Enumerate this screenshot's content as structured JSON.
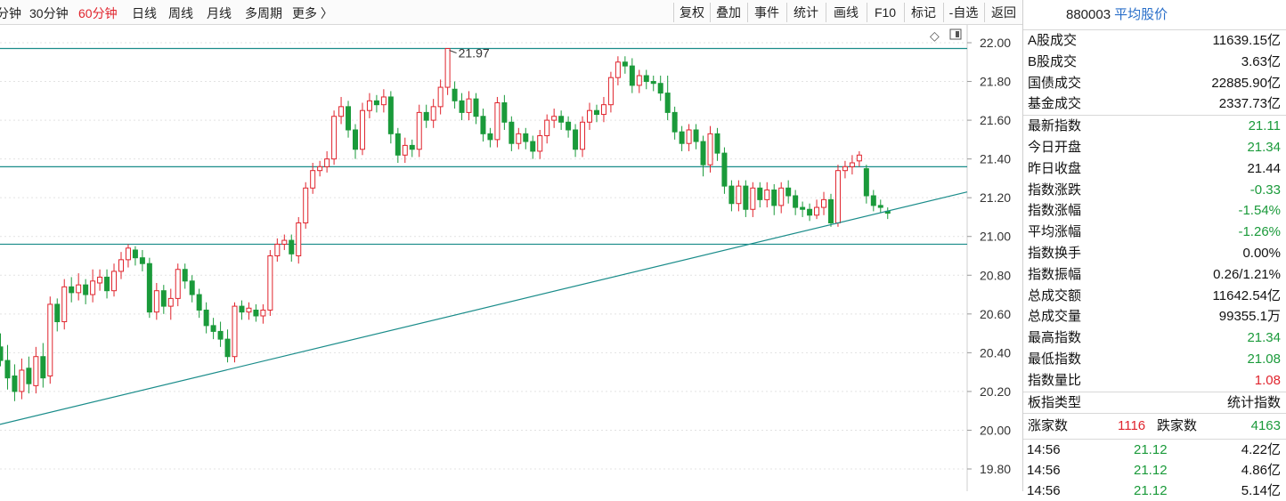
{
  "toolbar": {
    "periods": [
      {
        "label": "分钟",
        "active": false
      },
      {
        "label": "30分钟",
        "active": false
      },
      {
        "label": "60分钟",
        "active": true
      },
      {
        "label": "日线",
        "active": false
      },
      {
        "label": "周线",
        "active": false
      },
      {
        "label": "月线",
        "active": false
      },
      {
        "label": "多周期",
        "active": false
      },
      {
        "label": "更多 〉",
        "active": false
      }
    ],
    "tools": [
      "复权",
      "叠加",
      "事件",
      "统计",
      "画线",
      "F10",
      "标记",
      "-自选",
      "返回"
    ],
    "diamond_icon": "◇",
    "panel_icon": "□"
  },
  "chart": {
    "price_axis_ticks": [
      "22.00",
      "21.80",
      "21.60",
      "21.40",
      "21.20",
      "21.00",
      "20.80",
      "20.60",
      "20.40",
      "20.20",
      "20.00",
      "19.80"
    ],
    "high_marker_label": "21.97",
    "up_color": "#e0242d",
    "down_color": "#1a9a3a",
    "line_color": "#1a8c8a"
  },
  "chart_data": {
    "type": "candlestick",
    "period": "60分钟",
    "price_range": [
      19.8,
      22.0
    ],
    "horizontal_lines": [
      21.97,
      21.36,
      20.96
    ],
    "trendline": {
      "from_price": 20.03,
      "to_price": 21.23
    },
    "candles": [
      [
        20.43,
        20.36,
        20.5,
        20.33
      ],
      [
        20.36,
        20.27,
        20.44,
        20.21
      ],
      [
        20.28,
        20.2,
        20.34,
        20.15
      ],
      [
        20.2,
        20.31,
        20.37,
        20.16
      ],
      [
        20.32,
        20.24,
        20.38,
        20.19
      ],
      [
        20.23,
        20.38,
        20.43,
        20.19
      ],
      [
        20.38,
        20.27,
        20.45,
        20.22
      ],
      [
        20.28,
        20.65,
        20.69,
        20.24
      ],
      [
        20.65,
        20.56,
        20.68,
        20.51
      ],
      [
        20.56,
        20.74,
        20.78,
        20.52
      ],
      [
        20.74,
        20.71,
        20.79,
        20.66
      ],
      [
        20.71,
        20.75,
        20.81,
        20.67
      ],
      [
        20.75,
        20.7,
        20.78,
        20.65
      ],
      [
        20.7,
        20.77,
        20.83,
        20.66
      ],
      [
        20.76,
        20.79,
        20.83,
        20.72
      ],
      [
        20.79,
        20.72,
        20.83,
        20.68
      ],
      [
        20.72,
        20.82,
        20.86,
        20.69
      ],
      [
        20.82,
        20.88,
        20.92,
        20.78
      ],
      [
        20.88,
        20.94,
        20.96,
        20.84
      ],
      [
        20.93,
        20.89,
        20.95,
        20.85
      ],
      [
        20.89,
        20.86,
        20.93,
        20.82
      ],
      [
        20.86,
        20.61,
        20.89,
        20.58
      ],
      [
        20.61,
        20.72,
        20.76,
        20.57
      ],
      [
        20.72,
        20.64,
        20.75,
        20.6
      ],
      [
        20.64,
        20.68,
        20.73,
        20.57
      ],
      [
        20.68,
        20.83,
        20.86,
        20.64
      ],
      [
        20.83,
        20.77,
        20.86,
        20.73
      ],
      [
        20.77,
        20.7,
        20.8,
        20.66
      ],
      [
        20.7,
        20.62,
        20.73,
        20.58
      ],
      [
        20.62,
        20.54,
        20.66,
        20.5
      ],
      [
        20.54,
        20.51,
        20.58,
        20.47
      ],
      [
        20.51,
        20.47,
        20.56,
        20.43
      ],
      [
        20.47,
        20.38,
        20.52,
        20.35
      ],
      [
        20.38,
        20.64,
        20.66,
        20.35
      ],
      [
        20.64,
        20.61,
        20.67,
        20.57
      ],
      [
        20.61,
        20.63,
        20.66,
        20.57
      ],
      [
        20.62,
        20.59,
        20.65,
        20.56
      ],
      [
        20.59,
        20.62,
        20.65,
        20.55
      ],
      [
        20.62,
        20.9,
        20.93,
        20.59
      ],
      [
        20.9,
        20.96,
        20.99,
        20.87
      ],
      [
        20.96,
        20.98,
        21.01,
        20.93
      ],
      [
        20.98,
        20.91,
        21.01,
        20.87
      ],
      [
        20.9,
        21.07,
        21.1,
        20.86
      ],
      [
        21.07,
        21.25,
        21.28,
        21.04
      ],
      [
        21.25,
        21.34,
        21.38,
        21.22
      ],
      [
        21.34,
        21.36,
        21.39,
        21.31
      ],
      [
        21.36,
        21.4,
        21.44,
        21.33
      ],
      [
        21.4,
        21.62,
        21.65,
        21.37
      ],
      [
        21.62,
        21.67,
        21.72,
        21.58
      ],
      [
        21.67,
        21.55,
        21.7,
        21.51
      ],
      [
        21.55,
        21.45,
        21.58,
        21.4
      ],
      [
        21.45,
        21.65,
        21.69,
        21.42
      ],
      [
        21.65,
        21.7,
        21.74,
        21.61
      ],
      [
        21.7,
        21.68,
        21.73,
        21.64
      ],
      [
        21.68,
        21.72,
        21.76,
        21.64
      ],
      [
        21.72,
        21.53,
        21.75,
        21.48
      ],
      [
        21.53,
        21.42,
        21.56,
        21.38
      ],
      [
        21.42,
        21.47,
        21.51,
        21.38
      ],
      [
        21.47,
        21.45,
        21.5,
        21.41
      ],
      [
        21.45,
        21.64,
        21.68,
        21.41
      ],
      [
        21.64,
        21.6,
        21.68,
        21.56
      ],
      [
        21.6,
        21.67,
        21.71,
        21.56
      ],
      [
        21.67,
        21.77,
        21.81,
        21.63
      ],
      [
        21.77,
        21.97,
        21.97,
        21.73
      ],
      [
        21.76,
        21.7,
        21.8,
        21.66
      ],
      [
        21.7,
        21.64,
        21.74,
        21.6
      ],
      [
        21.64,
        21.71,
        21.75,
        21.6
      ],
      [
        21.71,
        21.62,
        21.74,
        21.58
      ],
      [
        21.62,
        21.53,
        21.66,
        21.49
      ],
      [
        21.53,
        21.5,
        21.56,
        21.46
      ],
      [
        21.5,
        21.69,
        21.72,
        21.46
      ],
      [
        21.69,
        21.59,
        21.73,
        21.55
      ],
      [
        21.59,
        21.48,
        21.62,
        21.44
      ],
      [
        21.48,
        21.53,
        21.56,
        21.45
      ],
      [
        21.53,
        21.49,
        21.56,
        21.45
      ],
      [
        21.49,
        21.44,
        21.52,
        21.4
      ],
      [
        21.44,
        21.52,
        21.55,
        21.4
      ],
      [
        21.52,
        21.6,
        21.63,
        21.48
      ],
      [
        21.6,
        21.62,
        21.66,
        21.56
      ],
      [
        21.62,
        21.59,
        21.65,
        21.55
      ],
      [
        21.59,
        21.55,
        21.62,
        21.51
      ],
      [
        21.55,
        21.45,
        21.58,
        21.41
      ],
      [
        21.45,
        21.59,
        21.62,
        21.41
      ],
      [
        21.59,
        21.65,
        21.69,
        21.55
      ],
      [
        21.65,
        21.63,
        21.68,
        21.59
      ],
      [
        21.63,
        21.68,
        21.72,
        21.59
      ],
      [
        21.68,
        21.82,
        21.85,
        21.64
      ],
      [
        21.82,
        21.9,
        21.93,
        21.78
      ],
      [
        21.9,
        21.88,
        21.93,
        21.84
      ],
      [
        21.88,
        21.78,
        21.92,
        21.74
      ],
      [
        21.78,
        21.83,
        21.86,
        21.74
      ],
      [
        21.83,
        21.8,
        21.86,
        21.76
      ],
      [
        21.8,
        21.79,
        21.83,
        21.75
      ],
      [
        21.79,
        21.74,
        21.83,
        21.7
      ],
      [
        21.74,
        21.64,
        21.83,
        21.6
      ],
      [
        21.64,
        21.54,
        21.67,
        21.5
      ],
      [
        21.54,
        21.48,
        21.57,
        21.44
      ],
      [
        21.48,
        21.55,
        21.58,
        21.44
      ],
      [
        21.55,
        21.49,
        21.58,
        21.45
      ],
      [
        21.49,
        21.37,
        21.52,
        21.31
      ],
      [
        21.37,
        21.53,
        21.57,
        21.33
      ],
      [
        21.53,
        21.43,
        21.56,
        21.39
      ],
      [
        21.43,
        21.26,
        21.46,
        21.22
      ],
      [
        21.26,
        21.17,
        21.29,
        21.13
      ],
      [
        21.17,
        21.26,
        21.29,
        21.13
      ],
      [
        21.26,
        21.14,
        21.29,
        21.1
      ],
      [
        21.14,
        21.25,
        21.28,
        21.1
      ],
      [
        21.25,
        21.19,
        21.28,
        21.15
      ],
      [
        21.19,
        21.24,
        21.28,
        21.15
      ],
      [
        21.24,
        21.16,
        21.27,
        21.11
      ],
      [
        21.16,
        21.25,
        21.28,
        21.12
      ],
      [
        21.25,
        21.21,
        21.29,
        21.17
      ],
      [
        21.21,
        21.15,
        21.24,
        21.11
      ],
      [
        21.15,
        21.14,
        21.18,
        21.1
      ],
      [
        21.14,
        21.11,
        21.17,
        21.08
      ],
      [
        21.11,
        21.15,
        21.19,
        21.09
      ],
      [
        21.15,
        21.19,
        21.23,
        21.11
      ],
      [
        21.19,
        21.07,
        21.22,
        21.05
      ],
      [
        21.07,
        21.34,
        21.37,
        21.05
      ],
      [
        21.34,
        21.36,
        21.39,
        21.3
      ],
      [
        21.36,
        21.38,
        21.42,
        21.32
      ],
      [
        21.39,
        21.42,
        21.44,
        21.36
      ],
      [
        21.35,
        21.21,
        21.37,
        21.17
      ],
      [
        21.21,
        21.16,
        21.24,
        21.13
      ],
      [
        21.16,
        21.15,
        21.19,
        21.12
      ],
      [
        21.13,
        21.12,
        21.15,
        21.09
      ]
    ]
  },
  "quote_panel": {
    "code": "880003",
    "name": "平均股价",
    "turnover_rows": [
      {
        "label": "A股成交",
        "value": "11639.15亿",
        "color": ""
      },
      {
        "label": "B股成交",
        "value": "3.63亿",
        "color": ""
      },
      {
        "label": "国债成交",
        "value": "22885.90亿",
        "color": ""
      },
      {
        "label": "基金成交",
        "value": "2337.73亿",
        "color": ""
      }
    ],
    "index_rows": [
      {
        "label": "最新指数",
        "value": "21.11",
        "color": "green"
      },
      {
        "label": "今日开盘",
        "value": "21.34",
        "color": "green"
      },
      {
        "label": "昨日收盘",
        "value": "21.44",
        "color": ""
      },
      {
        "label": "指数涨跌",
        "value": "-0.33",
        "color": "green"
      },
      {
        "label": "指数涨幅",
        "value": "-1.54%",
        "color": "green"
      },
      {
        "label": "平均涨幅",
        "value": "-1.26%",
        "color": "green"
      },
      {
        "label": "指数换手",
        "value": "0.00%",
        "color": ""
      },
      {
        "label": "指数振幅",
        "value": "0.26/1.21%",
        "color": ""
      },
      {
        "label": "总成交额",
        "value": "11642.54亿",
        "color": ""
      },
      {
        "label": "总成交量",
        "value": "99355.1万",
        "color": ""
      },
      {
        "label": "最高指数",
        "value": "21.34",
        "color": "green"
      },
      {
        "label": "最低指数",
        "value": "21.08",
        "color": "green"
      },
      {
        "label": "指数量比",
        "value": "1.08",
        "color": "red"
      }
    ],
    "type_row": {
      "label": "板指类型",
      "value": "统计指数"
    },
    "breadth": {
      "up_label": "涨家数",
      "up_count": "1116",
      "down_label": "跌家数",
      "down_count": "4163"
    },
    "ticks": [
      {
        "time": "14:56",
        "price": "21.12",
        "amount": "4.22亿"
      },
      {
        "time": "14:56",
        "price": "21.12",
        "amount": "4.86亿"
      },
      {
        "time": "14:56",
        "price": "21.12",
        "amount": "5.14亿"
      }
    ]
  }
}
